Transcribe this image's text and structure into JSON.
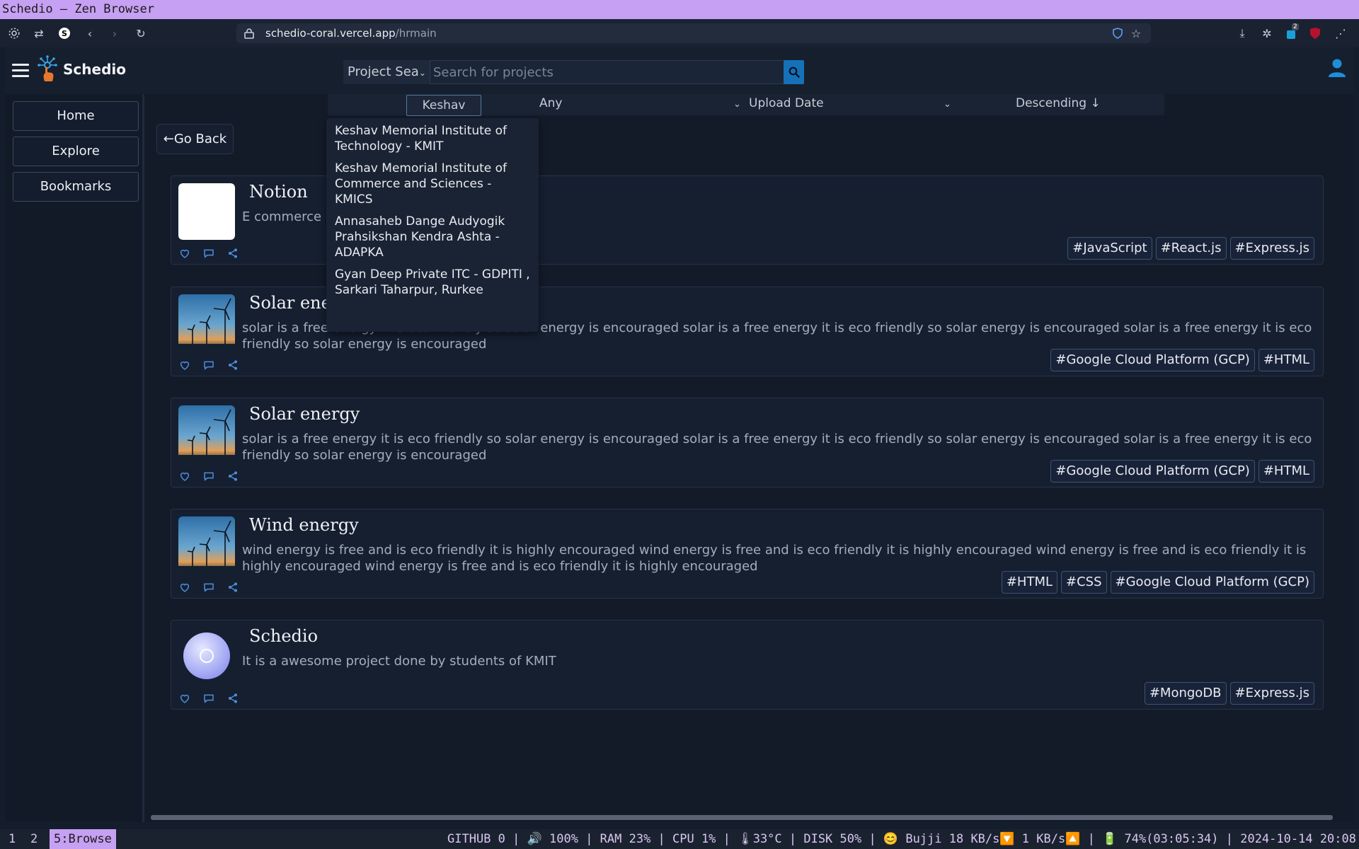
{
  "window": {
    "title": "Schedio — Zen Browser"
  },
  "browser": {
    "url_host": "schedio-coral.vercel.app",
    "url_path": "/hrmain",
    "extension_badge": "2"
  },
  "app": {
    "brand": "Schedio",
    "search": {
      "scope": "Project Sea",
      "placeholder": "Search for projects"
    },
    "filters": {
      "college": "Keshav",
      "domain": "Any",
      "sort_by": "Upload Date",
      "order": "Descending ↓"
    },
    "college_suggestions": [
      "Keshav Memorial Institute of Technology - KMIT",
      "Keshav Memorial Institute of Commerce and Sciences - KMICS",
      "Annasaheb Dange Audyogik Prahsikshan Kendra Ashta - ADAPKA",
      "Gyan Deep Private ITC - GDPITI , Sarkari Taharpur, Rurkee"
    ],
    "sidebar": [
      {
        "label": "Home"
      },
      {
        "label": "Explore"
      },
      {
        "label": "Bookmarks"
      }
    ],
    "go_back": "←Go Back",
    "projects": [
      {
        "title": "Notion",
        "description": "E commerce",
        "thumb": "blank",
        "tags": [
          "#JavaScript",
          "#React.js",
          "#Express.js"
        ]
      },
      {
        "title": "Solar energy",
        "description": "solar is a free energy it is eco friendly so solar energy is encouraged solar is a free energy it is eco friendly so solar energy is encouraged solar is a free energy it is eco friendly so solar energy is encouraged",
        "thumb": "wind",
        "tags": [
          "#Google Cloud Platform (GCP)",
          "#HTML"
        ]
      },
      {
        "title": "Solar energy",
        "description": "solar is a free energy it is eco friendly so solar energy is encouraged solar is a free energy it is eco friendly so solar energy is encouraged solar is a free energy it is eco friendly so solar energy is encouraged",
        "thumb": "wind",
        "tags": [
          "#Google Cloud Platform (GCP)",
          "#HTML"
        ]
      },
      {
        "title": "Wind energy",
        "description": "wind energy is free and is eco friendly it is highly encouraged wind energy is free and is eco friendly it is highly encouraged wind energy is free and is eco friendly it is highly encouraged wind energy is free and is eco friendly it is highly encouraged",
        "thumb": "wind",
        "tags": [
          "#HTML",
          "#CSS",
          "#Google Cloud Platform (GCP)"
        ]
      },
      {
        "title": "Schedio",
        "description": "It is a awesome project done by students of KMIT",
        "thumb": "circle",
        "tags": [
          "#MongoDB",
          "#Express.js"
        ]
      }
    ]
  },
  "statusbar": {
    "workspaces": [
      "1",
      "2",
      "5:Browse"
    ],
    "active_workspace": "5:Browse",
    "info": "GITHUB 0 | 🔊 100% | RAM 23% | CPU 1% | 🌡33°C | DISK 50% | 😊 Bujji 18 KB/s🔽 1 KB/s🔼 | 🔋 74%(03:05:34) | 2024-10-14 20:08"
  },
  "colors": {
    "accent": "#1572b8",
    "titlebar": "#c6a0f2",
    "background": "#131b29"
  }
}
